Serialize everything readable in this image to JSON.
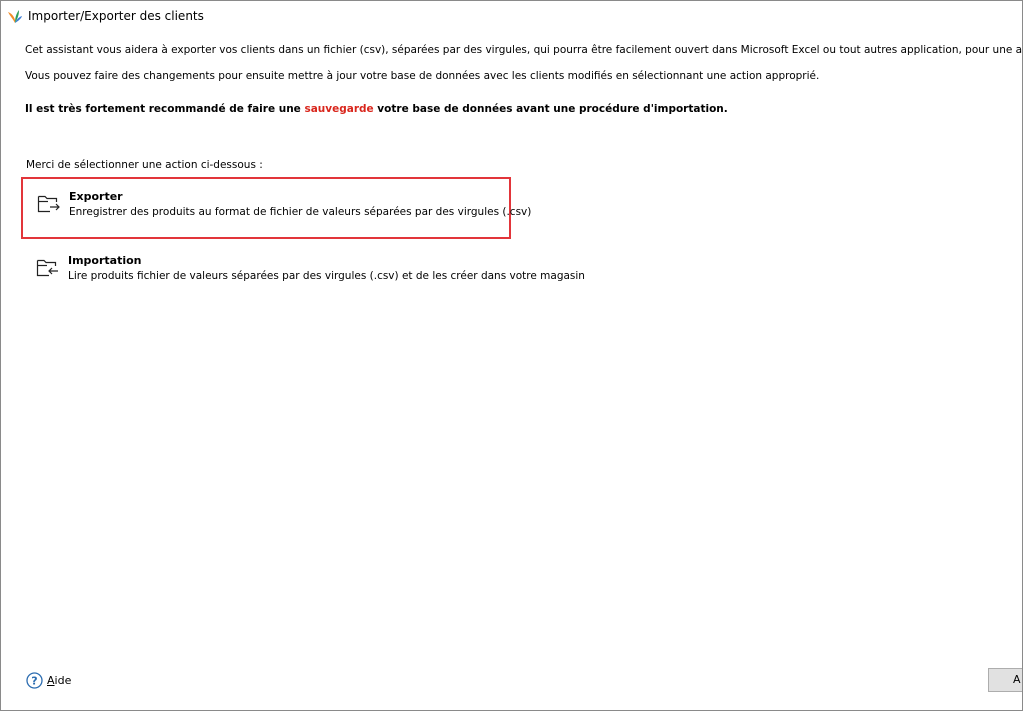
{
  "window": {
    "title": "Importer/Exporter des clients"
  },
  "intro": {
    "line1": "Cet assistant vous aidera à exporter vos clients dans un fichier (csv), séparées par des virgules, qui pourra être facilement ouvert dans Microsoft Excel ou tout autres application, pour une analyse détaillée.",
    "line2": "Vous pouvez faire des changements pour ensuite mettre à jour votre base de données avec les clients modifiés en sélectionnant une action approprié."
  },
  "warning": {
    "before": "Il est très fortement recommandé de faire une ",
    "highlight": "sauvegarde",
    "after": " votre base de données avant une procédure d'importation."
  },
  "prompt": "Merci de sélectionner une action ci-dessous :",
  "actions": [
    {
      "title": "Exporter",
      "description": "Enregistrer des produits au format de fichier de valeurs séparées par des virgules (.csv)",
      "icon": "folder-export-icon",
      "selected": true
    },
    {
      "title": "Importation",
      "description": "Lire produits fichier de valeurs séparées par des virgules (.csv) et de les créer dans votre magasin",
      "icon": "folder-import-icon",
      "selected": false
    }
  ],
  "footer": {
    "help_label": "Aide",
    "help_icon": "help-circle-icon",
    "next_label": "A"
  },
  "colors": {
    "highlight": "#d9261c",
    "selection_border": "#e2353a",
    "help_icon": "#2b6cb0"
  }
}
